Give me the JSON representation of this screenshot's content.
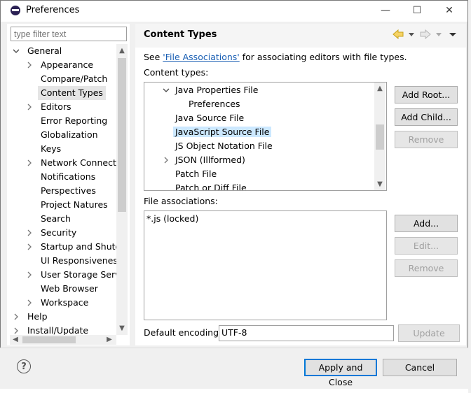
{
  "window": {
    "title": "Preferences",
    "minimize": "—",
    "maximize": "☐",
    "close": "✕"
  },
  "filter": {
    "placeholder": "type filter text"
  },
  "tree": [
    {
      "label": "General",
      "twisty": "v"
    },
    {
      "label": "Appearance",
      "twisty": ">"
    },
    {
      "label": "Compare/Patch",
      "twisty": ""
    },
    {
      "label": "Content Types",
      "twisty": "",
      "selected": true
    },
    {
      "label": "Editors",
      "twisty": ">"
    },
    {
      "label": "Error Reporting",
      "twisty": ""
    },
    {
      "label": "Globalization",
      "twisty": ""
    },
    {
      "label": "Keys",
      "twisty": ""
    },
    {
      "label": "Network Connecti",
      "twisty": ">"
    },
    {
      "label": "Notifications",
      "twisty": ""
    },
    {
      "label": "Perspectives",
      "twisty": ""
    },
    {
      "label": "Project Natures",
      "twisty": ""
    },
    {
      "label": "Search",
      "twisty": ""
    },
    {
      "label": "Security",
      "twisty": ">"
    },
    {
      "label": "Startup and Shutd",
      "twisty": ">"
    },
    {
      "label": "UI Responsiveness",
      "twisty": ""
    },
    {
      "label": "User Storage Serv",
      "twisty": ">"
    },
    {
      "label": "Web Browser",
      "twisty": ""
    },
    {
      "label": "Workspace",
      "twisty": ">"
    },
    {
      "label": "Help",
      "twisty": ">"
    },
    {
      "label": "Install/Update",
      "twisty": ">"
    }
  ],
  "page": {
    "title": "Content Types",
    "intro_before": "See ",
    "intro_link": "'File Associations'",
    "intro_after": " for associating editors with file types.",
    "content_types_label": "Content types:",
    "file_assoc_label": "File associations:",
    "encoding_label": "Default encoding:",
    "encoding_value": "UTF-8"
  },
  "content_types": [
    {
      "label": "Java Properties File",
      "twisty": "v"
    },
    {
      "label": "Preferences",
      "twisty": ""
    },
    {
      "label": "Java Source File",
      "twisty": ""
    },
    {
      "label": "JavaScript Source File",
      "twisty": "",
      "selected": true
    },
    {
      "label": "JS Object Notation File",
      "twisty": ""
    },
    {
      "label": "JSON (Illformed)",
      "twisty": ">"
    },
    {
      "label": "Patch File",
      "twisty": ""
    },
    {
      "label": "Patch or Diff File",
      "twisty": ""
    }
  ],
  "file_associations": [
    "*.js (locked)"
  ],
  "buttons": {
    "add_root": "Add Root...",
    "add_child": "Add Child...",
    "remove_ct": "Remove",
    "add": "Add...",
    "edit": "Edit...",
    "remove_fa": "Remove",
    "update": "Update",
    "apply_close": "Apply and Close",
    "cancel": "Cancel"
  },
  "colors": {
    "selection": "#cce8ff",
    "link": "#1a5fb4",
    "default_button_border": "#0078d7"
  }
}
